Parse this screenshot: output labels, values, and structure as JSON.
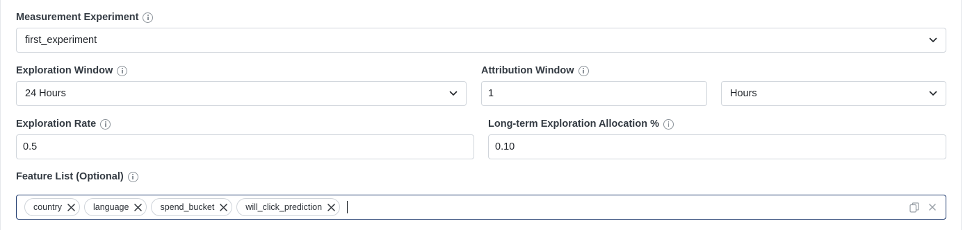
{
  "measurement": {
    "label": "Measurement Experiment",
    "value": "first_experiment"
  },
  "exploration_window": {
    "label": "Exploration Window",
    "value": "24 Hours"
  },
  "attribution_window": {
    "label": "Attribution Window",
    "value": "1",
    "unit": "Hours"
  },
  "exploration_rate": {
    "label": "Exploration Rate",
    "value": "0.5"
  },
  "long_term": {
    "label": "Long-term Exploration Allocation %",
    "value": "0.10"
  },
  "feature_list": {
    "label": "Feature List (Optional)",
    "chips": [
      "country",
      "language",
      "spend_bucket",
      "will_click_prediction"
    ]
  },
  "icons": {
    "info": "info-circle-icon",
    "dropdown": "chevron-down-icon",
    "remove": "close-icon",
    "copy": "copy-icon",
    "clear": "clear-icon"
  }
}
